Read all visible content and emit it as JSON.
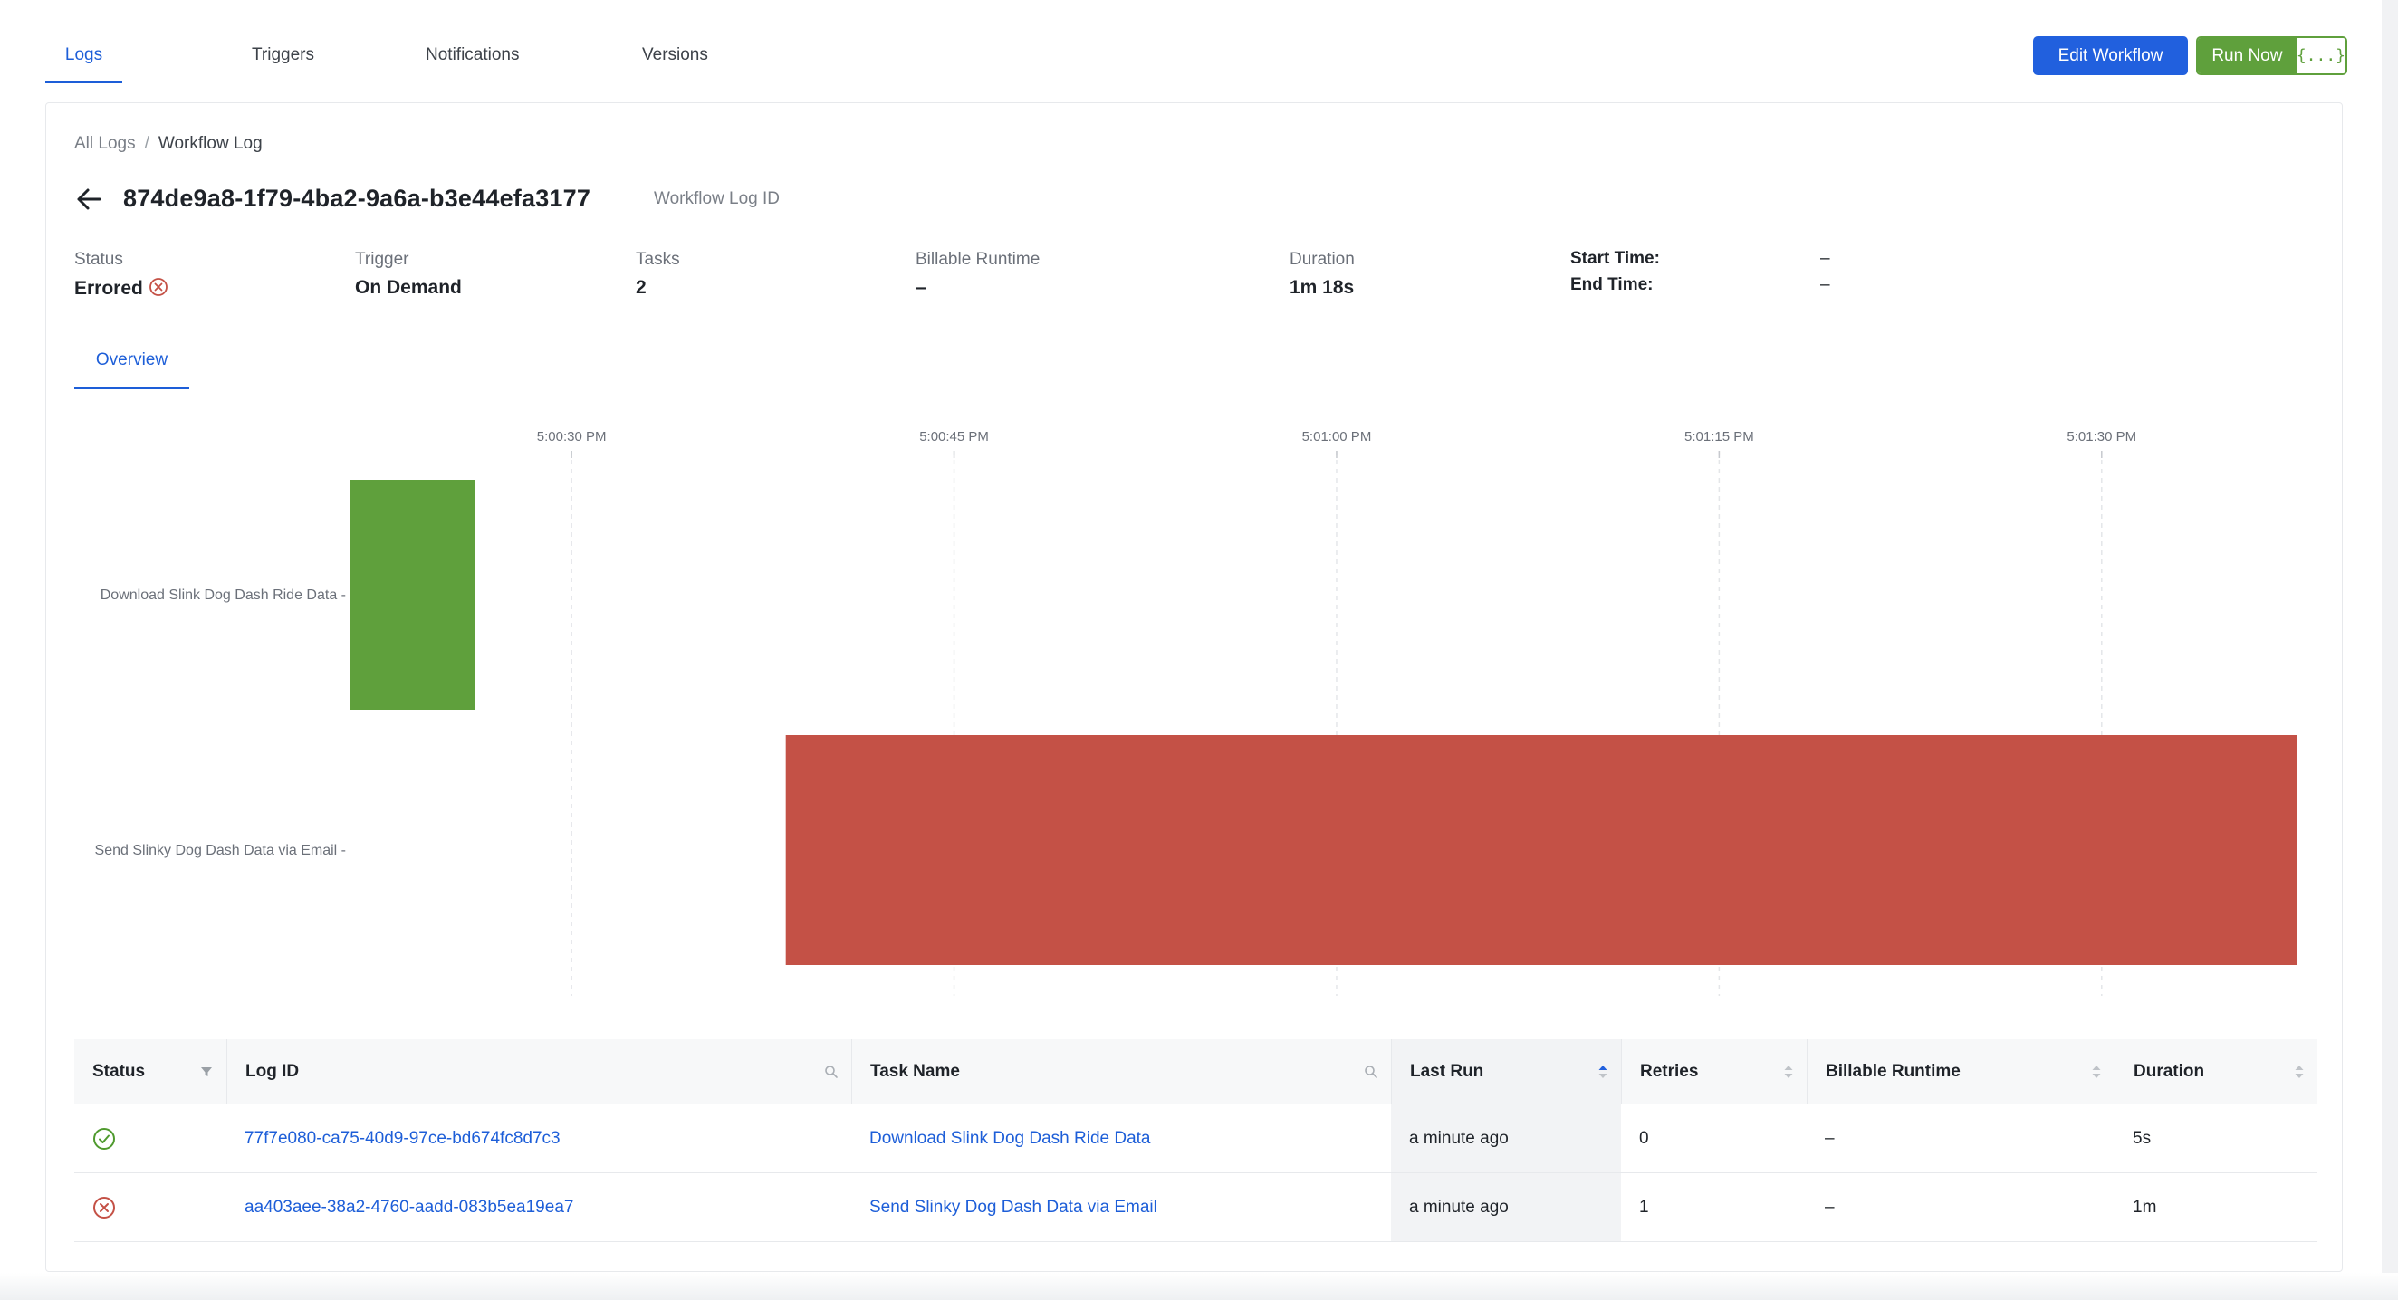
{
  "top_tabs": {
    "logs": "Logs",
    "triggers": "Triggers",
    "notifications": "Notifications",
    "versions": "Versions"
  },
  "actions": {
    "edit_workflow": "Edit Workflow",
    "run_now": "Run Now",
    "json_button": "{...}"
  },
  "breadcrumb": {
    "all_logs": "All Logs",
    "separator": "/",
    "current": "Workflow Log"
  },
  "header": {
    "log_id": "874de9a8-1f79-4ba2-9a6a-b3e44efa3177",
    "log_id_label": "Workflow Log ID"
  },
  "meta": {
    "status_label": "Status",
    "status_value": "Errored",
    "trigger_label": "Trigger",
    "trigger_value": "On Demand",
    "tasks_label": "Tasks",
    "tasks_value": "2",
    "billable_label": "Billable Runtime",
    "billable_value": "–",
    "duration_label": "Duration",
    "duration_value": "1m 18s",
    "start_time_label": "Start Time:",
    "start_time_value": "–",
    "end_time_label": "End Time:",
    "end_time_value": "–"
  },
  "sub_tabs": {
    "overview": "Overview"
  },
  "chart_data": {
    "type": "bar",
    "orientation": "horizontal-gantt",
    "x_ticks": [
      "5:00:30 PM",
      "5:00:45 PM",
      "5:01:00 PM",
      "5:01:15 PM",
      "5:01:30 PM"
    ],
    "x_tick_seconds": [
      30,
      45,
      60,
      75,
      90
    ],
    "x_range_seconds": [
      10.5,
      97.5
    ],
    "categories": [
      "Download Slink Dog Dash Ride Data",
      "Send Slinky Dog Dash Data via Email"
    ],
    "series": [
      {
        "values": [
          {
            "task": "Download Slink Dog Dash Ride Data",
            "start_second": 21.3,
            "end_second": 26.2,
            "status": "success"
          },
          {
            "task": "Send Slinky Dog Dash Data via Email",
            "start_second": 38.4,
            "end_second": 97.9,
            "status": "error"
          }
        ]
      }
    ],
    "colors": {
      "success": "#5fa03c",
      "error": "#c45146"
    },
    "grid": "vertical-dashed",
    "legend": "none"
  },
  "table": {
    "headers": {
      "status": "Status",
      "log_id": "Log ID",
      "task_name": "Task Name",
      "last_run": "Last Run",
      "retries": "Retries",
      "billable_runtime": "Billable Runtime",
      "duration": "Duration"
    },
    "rows": [
      {
        "status": "success",
        "log_id": "77f7e080-ca75-40d9-97ce-bd674fc8d7c3",
        "task_name": "Download Slink Dog Dash Ride Data",
        "last_run": "a minute ago",
        "retries": "0",
        "billable_runtime": "–",
        "duration": "5s"
      },
      {
        "status": "error",
        "log_id": "aa403aee-38a2-4760-aadd-083b5ea19ea7",
        "task_name": "Send Slinky Dog Dash Data via Email",
        "last_run": "a minute ago",
        "retries": "1",
        "billable_runtime": "–",
        "duration": "1m"
      }
    ]
  },
  "colors": {
    "primary": "#2160de",
    "success": "#5fa03c",
    "error": "#c45146"
  }
}
